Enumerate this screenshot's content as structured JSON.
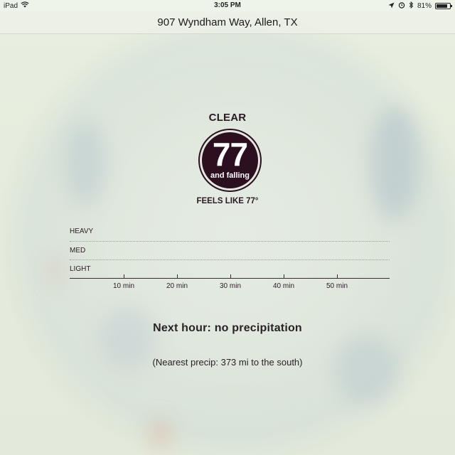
{
  "status_bar": {
    "device": "iPad",
    "time": "3:05 PM",
    "battery": "81%",
    "battery_level": 0.81,
    "icons": [
      "wifi-icon",
      "location-arrow-icon",
      "alarm-icon",
      "bluetooth-icon",
      "battery-icon"
    ]
  },
  "location": "907 Wyndham Way, Allen, TX",
  "current": {
    "condition": "CLEAR",
    "temperature": "77",
    "trend": "and falling",
    "feels_like": "FEELS LIKE 77°"
  },
  "precip_graph": {
    "levels": [
      "HEAVY",
      "MED",
      "LIGHT"
    ],
    "ticks": [
      "10 min",
      "20 min",
      "30 min",
      "40 min",
      "50 min"
    ]
  },
  "next_hour": "Next hour: no precipitation",
  "nearest_precip": "(Nearest precip: 373 mi to the south)",
  "colors": {
    "accent": "#2d1020",
    "background": "#e9efe1"
  }
}
